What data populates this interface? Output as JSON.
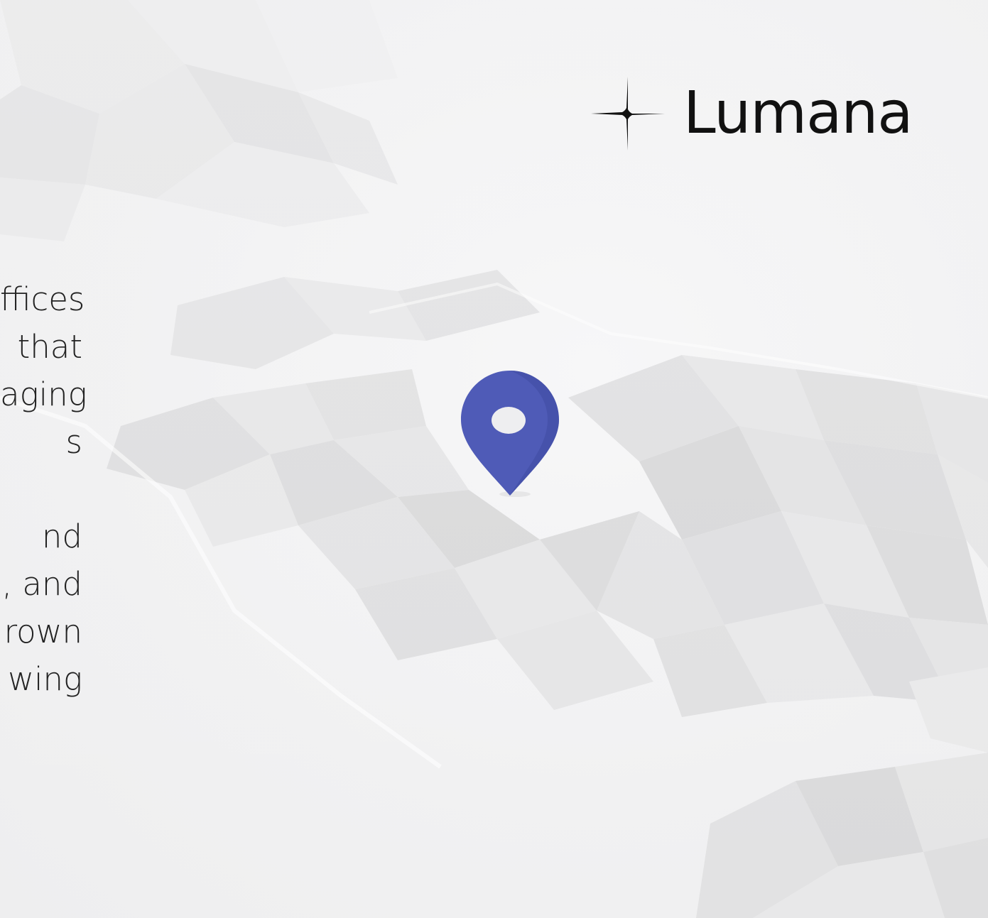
{
  "brand": {
    "name": "Lumana",
    "icon": "four-point-spark-icon"
  },
  "left_text": {
    "paragraph1": [
      "ffices",
      "that",
      "aging",
      "s"
    ],
    "paragraph2": [
      "nd",
      ", and",
      "rown",
      "wing"
    ]
  },
  "map_pin": {
    "icon": "location-pin-icon",
    "color": "#4f5bb7"
  },
  "colors": {
    "background": "#f2f2f3",
    "text": "#222222",
    "pin": "#4f5bb7"
  }
}
